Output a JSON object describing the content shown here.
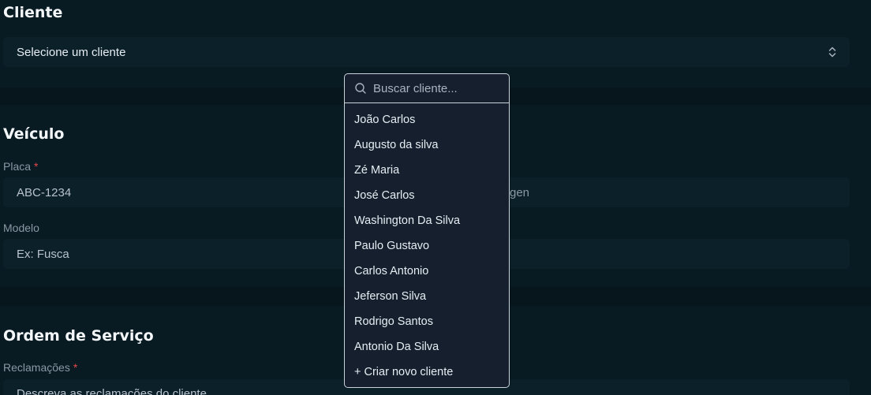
{
  "cliente": {
    "title": "Cliente",
    "select_value": "Selecione um cliente"
  },
  "veiculo": {
    "title": "Veículo",
    "placa_label": "Placa",
    "placa_value": "ABC-1234",
    "marca_partial": "gen",
    "modelo_label": "Modelo",
    "modelo_placeholder": "Ex: Fusca"
  },
  "ordem": {
    "title": "Ordem de Serviço",
    "reclamacoes_label": "Reclamações",
    "reclamacoes_placeholder": "Descreva as reclamações do cliente"
  },
  "required_mark": "*",
  "dropdown": {
    "search_placeholder": "Buscar cliente...",
    "items": [
      "João Carlos",
      "Augusto da silva",
      "Zé Maria",
      "José Carlos",
      "Washington Da Silva",
      "Paulo Gustavo",
      "Carlos Antonio",
      "Jeferson Silva",
      "Rodrigo Santos",
      "Antonio Da Silva",
      "+ Criar novo cliente"
    ]
  },
  "colors": {
    "background": "#07161d",
    "input_background": "#0c2029",
    "dropdown_background": "#151f2e",
    "required": "#e5484d"
  }
}
